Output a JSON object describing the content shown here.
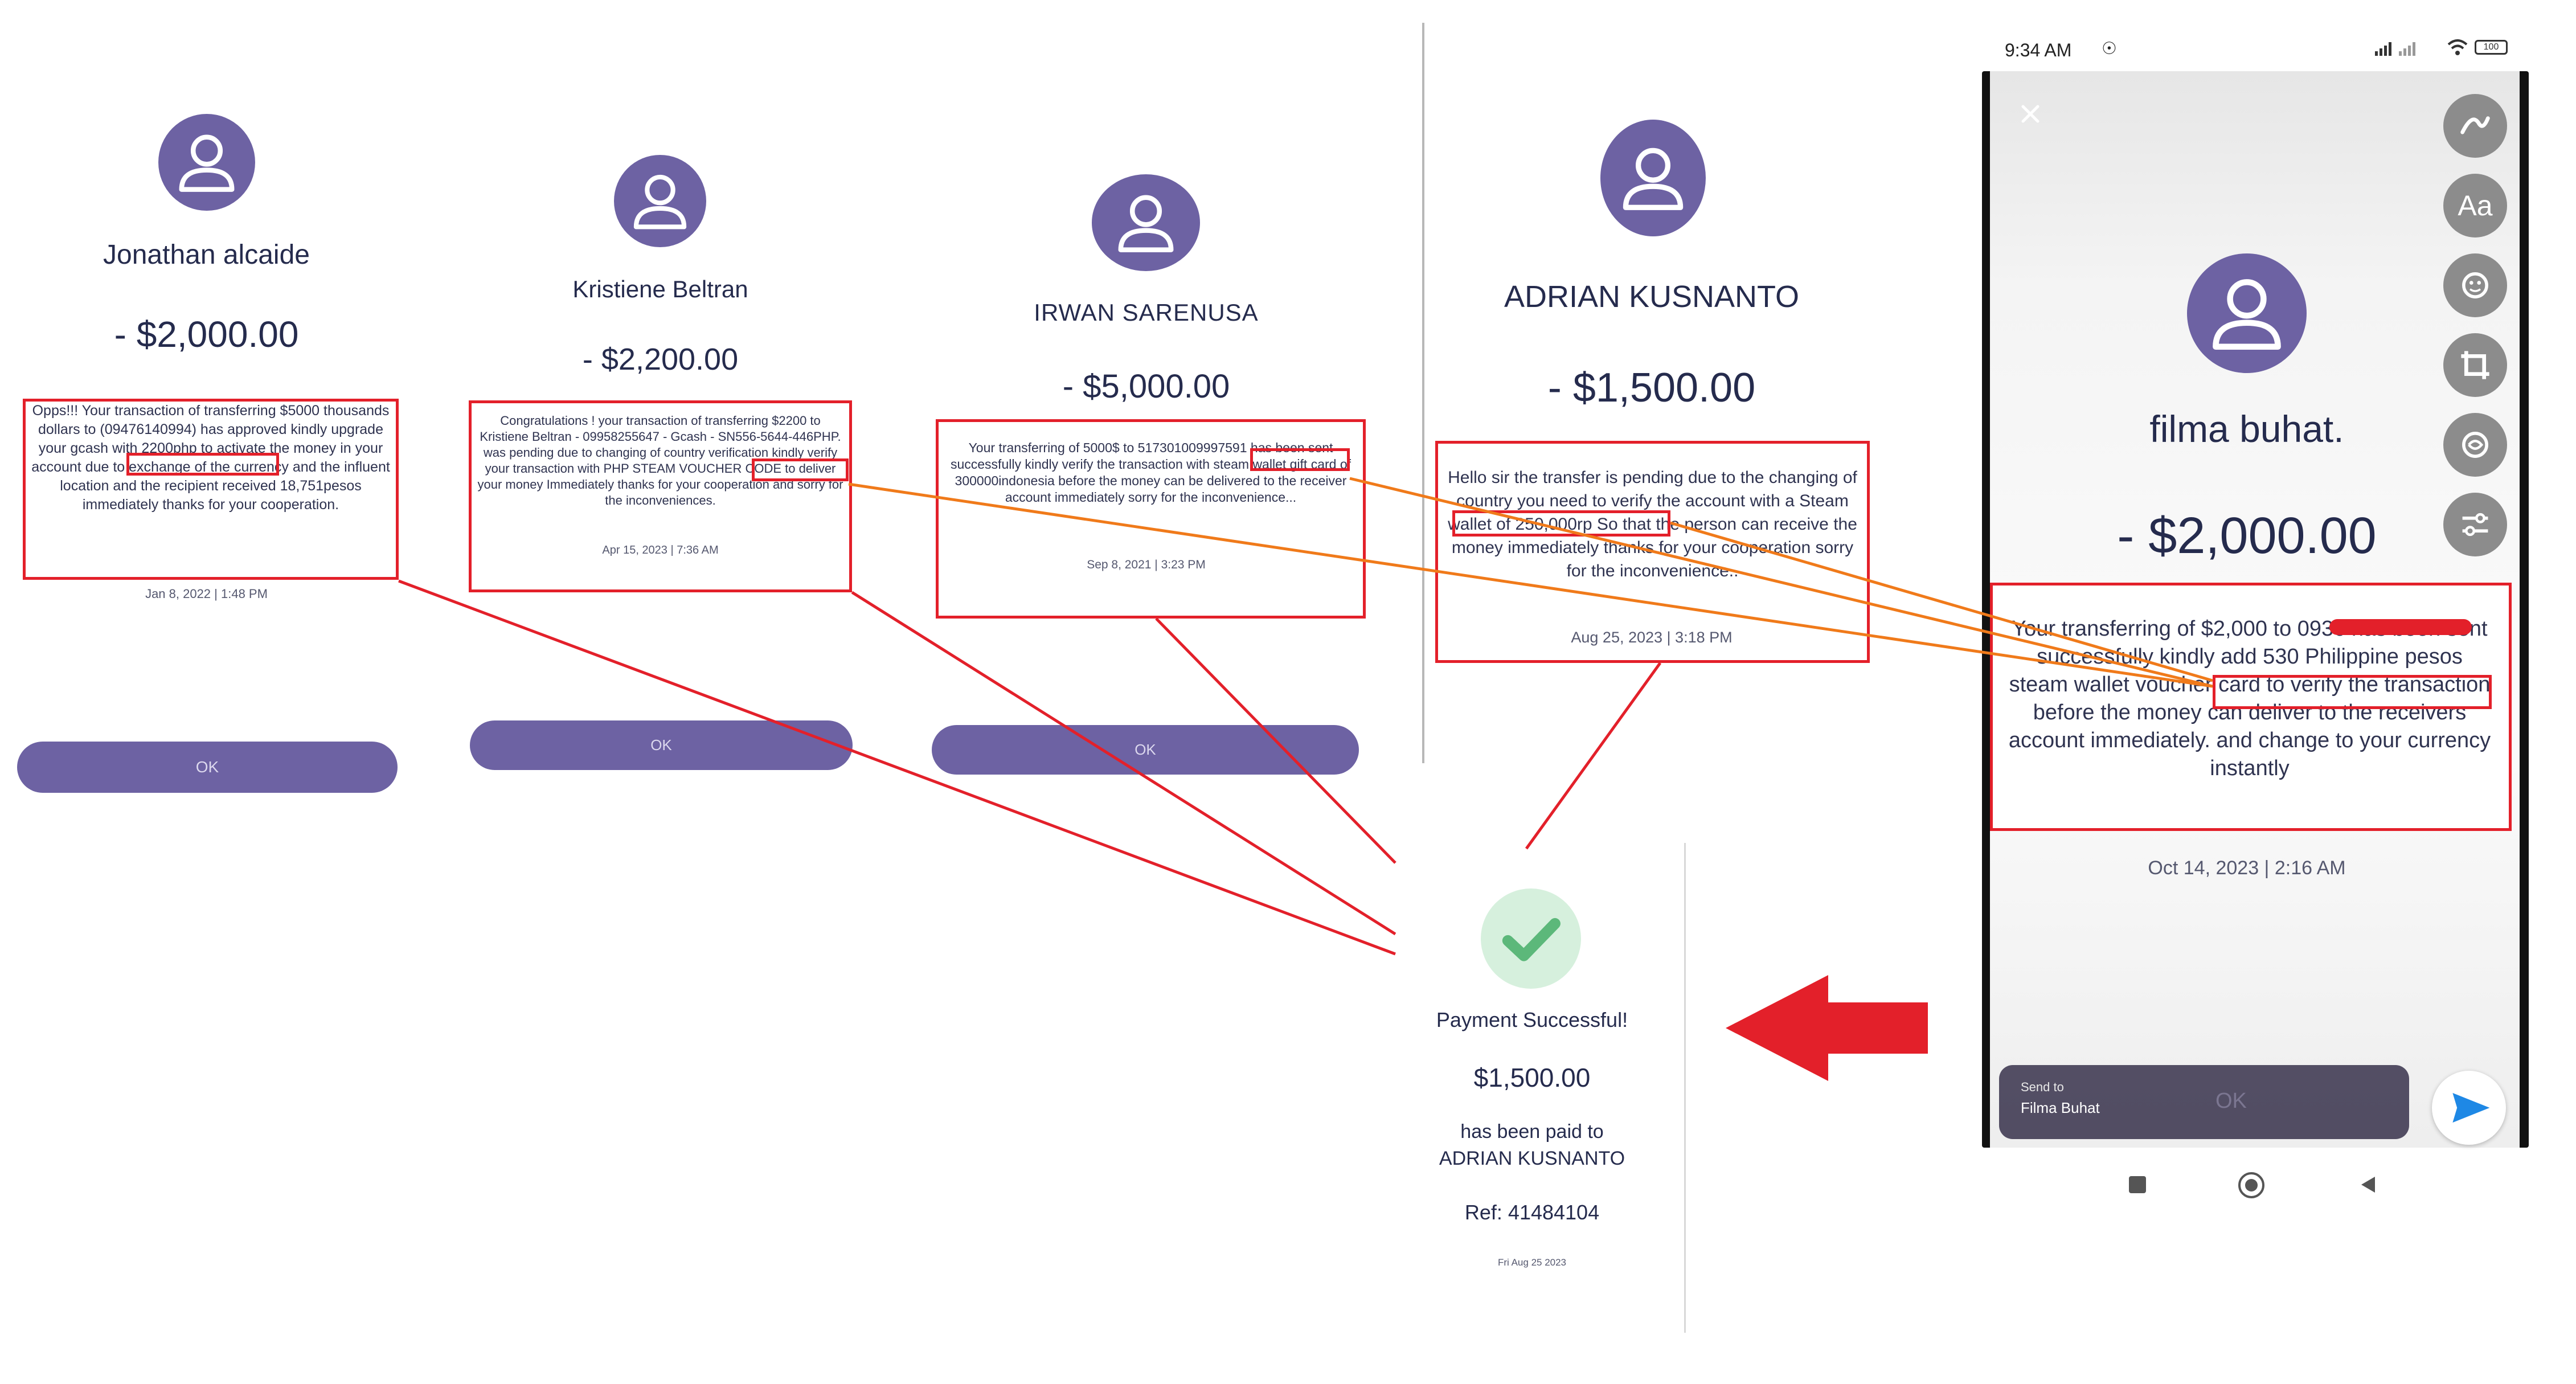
{
  "screens": [
    {
      "name": "Jonathan alcaide",
      "amount": "- $2,000.00",
      "message": "Opps!!! Your transaction of transferring $5000 thousands dollars to (09476140994) has approved kindly upgrade your gcash with 2200php to activate the money in your account due to exchange of the currency and the influent location and the recipient received 18,751pesos immediately thanks for your cooperation.",
      "highlight": "gcash with 2200php",
      "date": "Jan 8, 2022 | 1:48 PM",
      "ok": "OK"
    },
    {
      "name": "Kristiene Beltran",
      "amount": "- $2,200.00",
      "message": "Congratulations ! your transaction of transferring $2200 to Kristiene Beltran - 09958255647 - Gcash - SN556-5644-446PHP. was pending due to changing of country verification kindly verify your transaction with PHP STEAM VOUCHER CODE to deliver your money Immediately thanks for your cooperation and sorry for the inconveniences.",
      "highlight": "PHP STEAM",
      "date": "Apr 15, 2023 | 7:36 AM",
      "ok": "OK"
    },
    {
      "name": "IRWAN SARENUSA",
      "amount": "- $5,000.00",
      "message": "Your transferring of 5000$ to 517301009997591 has been sent successfully kindly verify the transaction with steam wallet gift card of 300000indonesia before the money can be delivered to the receiver account immediately sorry for the inconvenience...",
      "highlight": "with steam",
      "date": "Sep 8, 2021 | 3:23 PM",
      "ok": "OK"
    },
    {
      "name": "ADRIAN KUSNANTO",
      "amount": "- $1,500.00",
      "message": "Hello sir the transfer is pending due to the changing of country you need to verify the account with a Steam wallet of 250,000rp So that the person can receive the money immediately thanks for your cooperation sorry for the inconvenience..",
      "highlight": "Steam wallet of 250,000rp",
      "date": "Aug 25, 2023 | 3:18 PM"
    }
  ],
  "payment": {
    "title": "Payment Successful!",
    "amount": "$1,500.00",
    "paid_to_label": "has been paid to",
    "recipient": "ADRIAN KUSNANTO",
    "ref": "Ref: 41484104",
    "date": "Fri Aug 25 2023"
  },
  "phone": {
    "status_time": "9:34 AM",
    "battery": "100",
    "name": "filma buhat.",
    "amount": "- $2,000.00",
    "message": "Your transferring of $2,000 to 0936 has been sent successfully kindly add 530 Philippine pesos steam wallet voucher card to verify the transaction before the money can deliver to the receivers account immediately. and change to your currency instantly",
    "highlight": "steam wallet voucher",
    "date": "Oct 14, 2023 | 2:16 AM",
    "text_tool": "Aa",
    "send_to_label": "Send to",
    "send_to_name": "Filma Buhat",
    "ok": "OK"
  },
  "colors": {
    "avatar": "#6d62a3",
    "annotation_red": "#e3202a",
    "annotation_orange": "#f07a1a",
    "success_green": "#5cb87a"
  }
}
